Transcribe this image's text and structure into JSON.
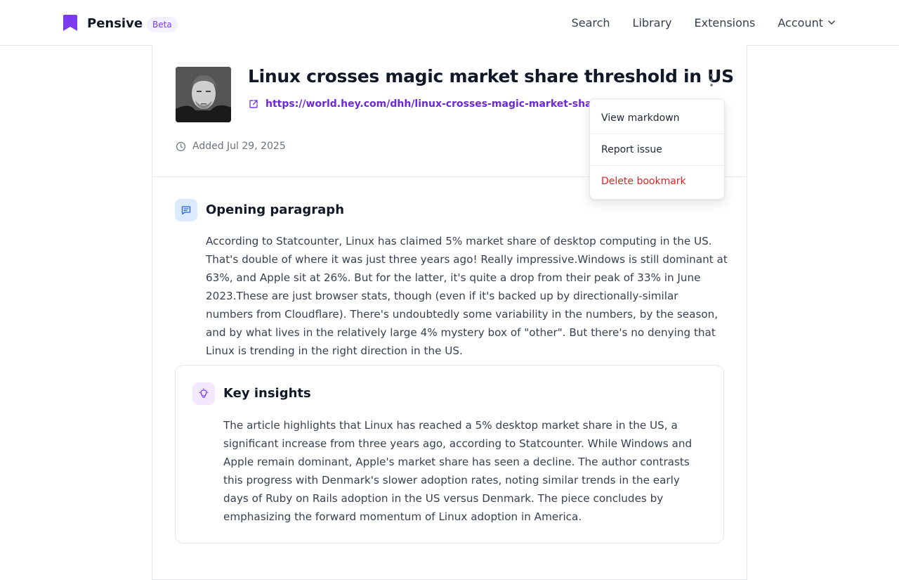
{
  "brand": {
    "name": "Pensive",
    "badge": "Beta",
    "accent": "#7c3aed"
  },
  "nav": {
    "items": [
      "Search",
      "Library",
      "Extensions"
    ],
    "account_label": "Account"
  },
  "bookmark": {
    "title": "Linux crosses magic market share threshold in US",
    "url": "https://world.hey.com/dhh/linux-crosses-magic-market-share-threshold",
    "added": "Added Jul 29, 2025",
    "icons": {
      "link": "external-link-icon",
      "added": "clock-icon",
      "menu": "more-vertical-icon"
    }
  },
  "menu": {
    "items": [
      "View markdown",
      "Report issue",
      "Delete bookmark"
    ],
    "danger_color": "#dc2626"
  },
  "opening": {
    "title": "Opening paragraph",
    "icon": "message-square-icon",
    "body": "According to Statcounter, Linux has claimed 5% market share of desktop computing in the US. That's double of where it was just three years ago! Really impressive.Windows is still dominant at 63%, and Apple sit at 26%. But for the latter, it's quite a drop from their peak of 33% in June 2023.These are just browser stats, though (even if it's backed up by directionally-similar numbers from Cloudflare). There's undoubtedly some variability in the numbers, by the season, and by what lives in the relatively large 4% mystery box of \"other\". But there's no denying that Linux is trending in the right direction in the US."
  },
  "insights": {
    "title": "Key insights",
    "icon": "lightbulb-icon",
    "body": "The article highlights that Linux has reached a 5% desktop market share in the US, a significant increase from three years ago, according to Statcounter. While Windows and Apple remain dominant, Apple's market share has seen a decline. The author contrasts this progress with Denmark's slower adoption rates, noting similar trends in the early days of Ruby on Rails adoption in the US versus Denmark. The piece concludes by emphasizing the forward momentum of Linux adoption in America."
  }
}
